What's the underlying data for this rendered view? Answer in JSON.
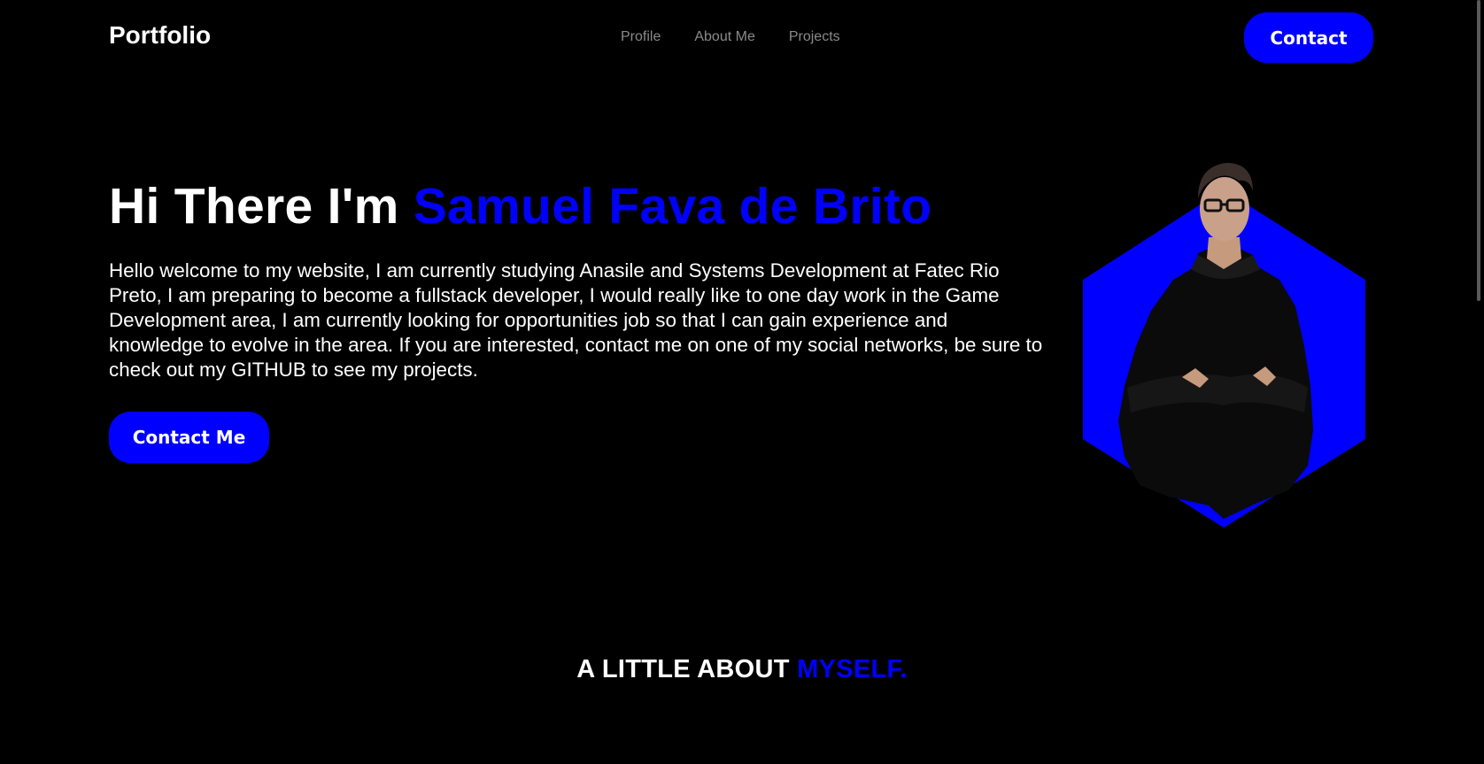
{
  "header": {
    "brand": "Portfolio",
    "nav": [
      {
        "label": "Profile"
      },
      {
        "label": "About Me"
      },
      {
        "label": "Projects"
      }
    ],
    "contact_label": "Contact"
  },
  "hero": {
    "greeting": "Hi There I'm ",
    "name": "Samuel Fava de Brito",
    "description": "Hello welcome to my website, I am currently studying Anasile and Systems Development at Fatec Rio Preto, I am preparing to become a fullstack developer, I would really like to one day work in the Game Development area, I am currently looking for opportunities job so that I can gain experience and knowledge to evolve in the area. If you are interested, contact me on one of my social networks, be sure to check out my GITHUB to see my projects.",
    "cta_label": "Contact Me"
  },
  "about": {
    "title_prefix": "A LITTLE ABOUT ",
    "title_accent": "MYSELF."
  },
  "colors": {
    "accent": "#0000ff",
    "background": "#000000",
    "text": "#ffffff",
    "nav_text": "#8a8a8a"
  }
}
